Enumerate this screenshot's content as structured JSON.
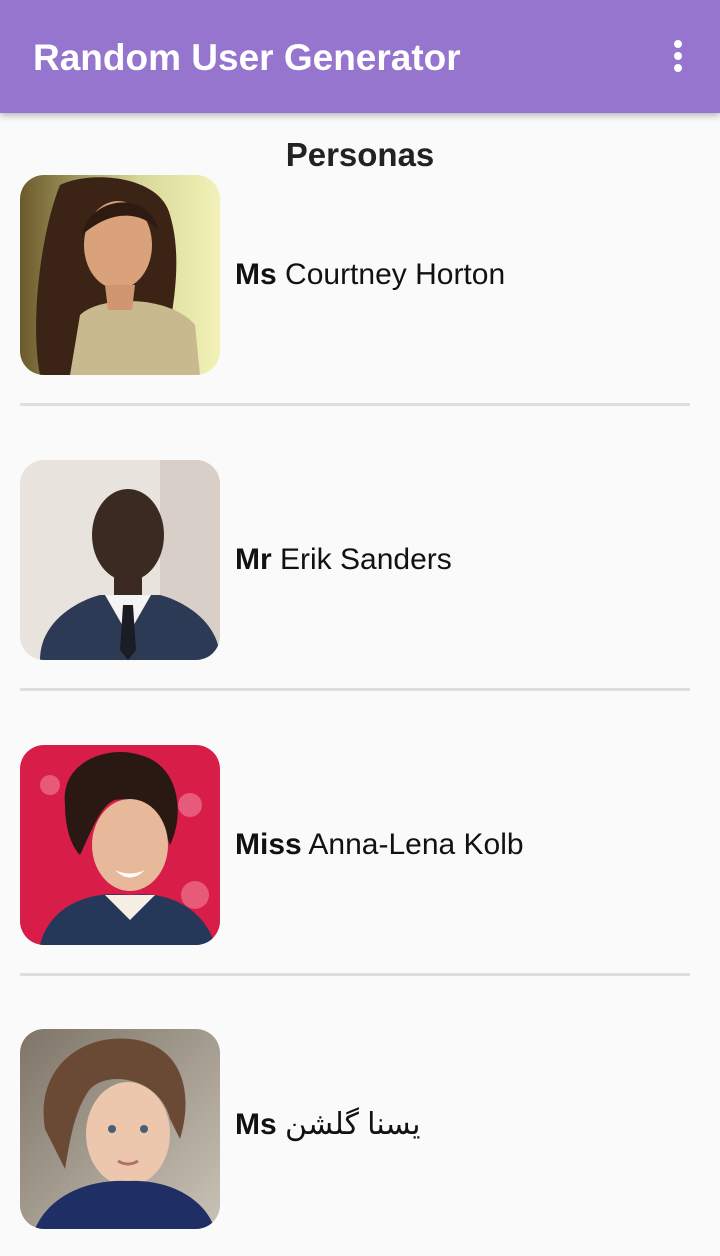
{
  "app_bar": {
    "title": "Random User Generator",
    "menu_icon": "more-vert-icon",
    "color": "#9575cd"
  },
  "section_title": "Personas",
  "users": [
    {
      "title": "Ms",
      "name": "Courtney Horton",
      "avatar": "photo-woman-long-dark-hair"
    },
    {
      "title": "Mr",
      "name": "Erik Sanders",
      "avatar": "photo-man-suit-tie"
    },
    {
      "title": "Miss",
      "name": "Anna-Lena Kolb",
      "avatar": "photo-woman-curly-hair-red-background"
    },
    {
      "title": "Ms",
      "name": "یسنا گلشن",
      "avatar": "photo-woman-hair-up-blue-top"
    }
  ]
}
